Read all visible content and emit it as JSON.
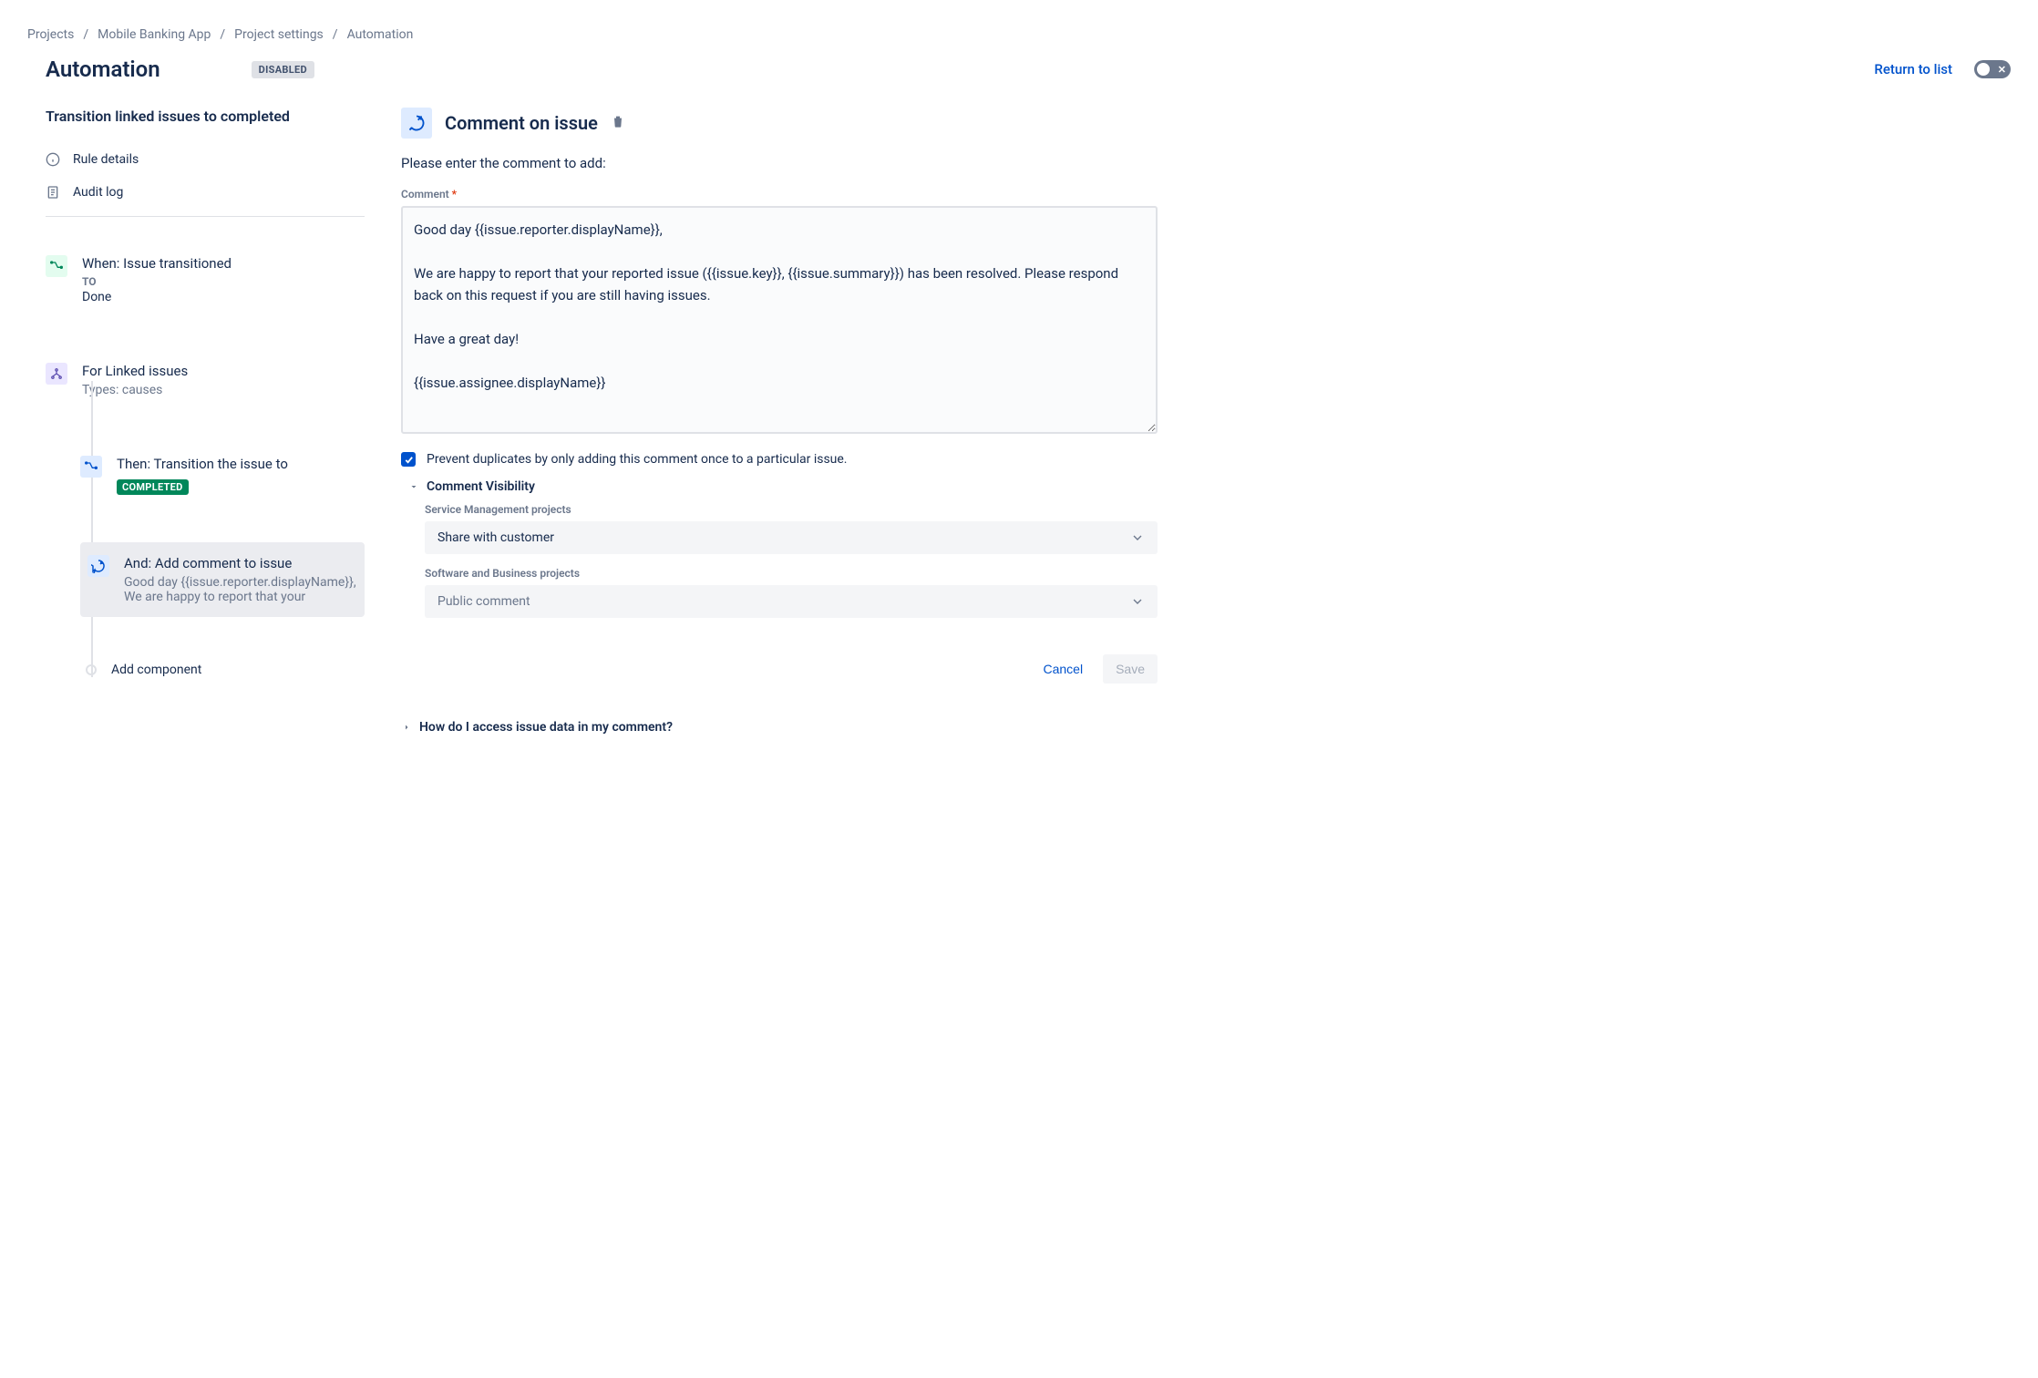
{
  "breadcrumb": {
    "projects": "Projects",
    "project_name": "Mobile Banking App",
    "settings": "Project settings",
    "current": "Automation"
  },
  "header": {
    "title": "Automation",
    "status_badge": "DISABLED",
    "return_link": "Return to list"
  },
  "sidebar": {
    "rule_title": "Transition linked issues to completed",
    "rule_details": "Rule details",
    "audit_log": "Audit log"
  },
  "chain": {
    "when": {
      "title": "When: Issue transitioned",
      "sub": "TO",
      "value": "Done"
    },
    "for": {
      "title": "For Linked issues",
      "meta": "Types: causes"
    },
    "then": {
      "title": "Then: Transition the issue to",
      "badge": "COMPLETED"
    },
    "and": {
      "title": "And: Add comment to issue",
      "preview": "Good day {{issue.reporter.displayName}}, We are happy to report that your"
    },
    "add_component": "Add component"
  },
  "content": {
    "title": "Comment on issue",
    "description": "Please enter the comment to add:",
    "comment_label": "Comment",
    "comment_value": "Good day {{issue.reporter.displayName}},\n\nWe are happy to report that your reported issue ({{issue.key}}, {{issue.summary}}) has been resolved. Please respond back on this request if you are still having issues.\n\nHave a great day!\n\n{{issue.assignee.displayName}}",
    "prevent_duplicates": "Prevent duplicates by only adding this comment once to a particular issue.",
    "visibility": {
      "title": "Comment Visibility",
      "sm_label": "Service Management projects",
      "sm_value": "Share with customer",
      "sb_label": "Software and Business projects",
      "sb_value": "Public comment"
    },
    "access_data": "How do I access issue data in my comment?",
    "cancel": "Cancel",
    "save": "Save"
  }
}
